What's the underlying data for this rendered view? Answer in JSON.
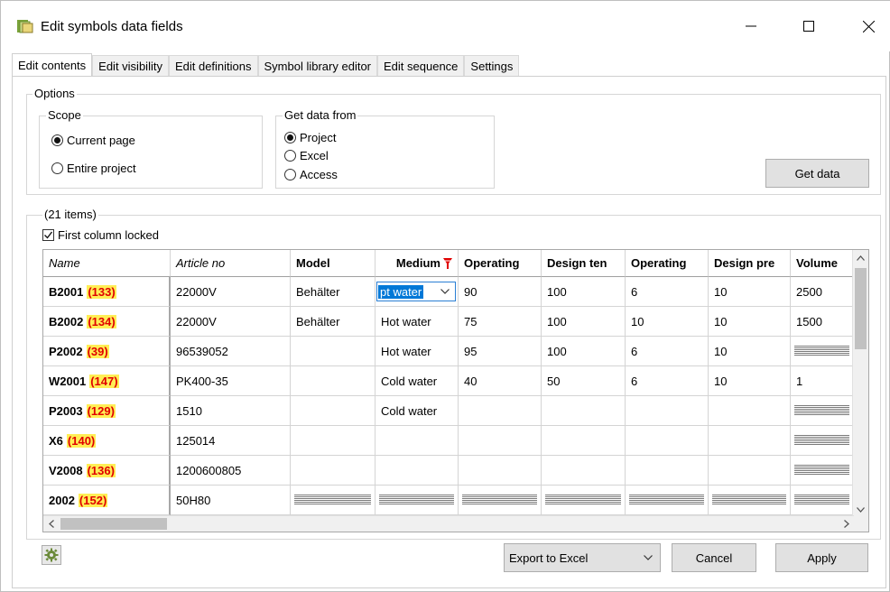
{
  "window": {
    "title": "Edit symbols data fields"
  },
  "tabs": [
    "Edit contents",
    "Edit visibility",
    "Edit definitions",
    "Symbol library editor",
    "Edit sequence",
    "Settings"
  ],
  "options": {
    "label": "Options",
    "scope": {
      "label": "Scope",
      "items": [
        "Current page",
        "Entire project"
      ],
      "selected": "Current page"
    },
    "source": {
      "label": "Get data from",
      "items": [
        "Project",
        "Excel",
        "Access"
      ],
      "selected": "Project"
    },
    "get_data_label": "Get data"
  },
  "list": {
    "count_label": "(21 items)",
    "first_column_locked_label": "First column locked",
    "first_column_locked": true,
    "columns": [
      "Name",
      "Article no",
      "Model",
      "Medium",
      "Operating",
      "Design ten",
      "Operating",
      "Design pre",
      "Volume"
    ],
    "rows": [
      {
        "name": "B2001",
        "num": "(133)",
        "article": "22000V",
        "model": "Behälter",
        "medium": "pt water",
        "op1": "90",
        "design_t": "100",
        "op2": "6",
        "design_p": "10",
        "volume": "2500"
      },
      {
        "name": "B2002",
        "num": "(134)",
        "article": "22000V",
        "model": "Behälter",
        "medium": "Hot water",
        "op1": "75",
        "design_t": "100",
        "op2": "10",
        "design_p": "10",
        "volume": "1500"
      },
      {
        "name": "P2002",
        "num": "(39)",
        "article": "96539052",
        "model": "",
        "medium": "Hot water",
        "op1": "95",
        "design_t": "100",
        "op2": "6",
        "design_p": "10",
        "volume": ""
      },
      {
        "name": "W2001",
        "num": "(147)",
        "article": "PK400-35",
        "model": "",
        "medium": "Cold water",
        "op1": "40",
        "design_t": "50",
        "op2": "6",
        "design_p": "10",
        "volume": "1"
      },
      {
        "name": "P2003",
        "num": "(129)",
        "article": "1510",
        "model": "",
        "medium": "Cold water",
        "op1": "",
        "design_t": "",
        "op2": "",
        "design_p": "",
        "volume": ""
      },
      {
        "name": "X6",
        "num": "(140)",
        "article": "125014",
        "model": "",
        "medium": "",
        "op1": "",
        "design_t": "",
        "op2": "",
        "design_p": "",
        "volume": ""
      },
      {
        "name": "V2008",
        "num": "(136)",
        "article": "1200600805",
        "model": "",
        "medium": "",
        "op1": "",
        "design_t": "",
        "op2": "",
        "design_p": "",
        "volume": ""
      },
      {
        "name": "2002",
        "num": "(152)",
        "article": "50H80",
        "model": "",
        "medium": "",
        "op1": "",
        "design_t": "",
        "op2": "",
        "design_p": "",
        "volume": ""
      }
    ]
  },
  "footer": {
    "export_label": "Export to Excel",
    "cancel_label": "Cancel",
    "apply_label": "Apply"
  }
}
